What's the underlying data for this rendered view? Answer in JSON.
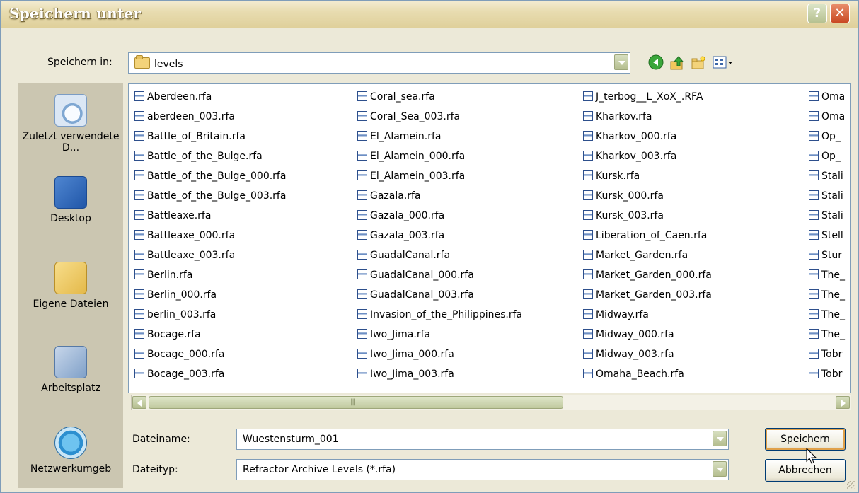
{
  "window": {
    "title": "Speichern unter"
  },
  "save_in": {
    "label": "Speichern in:",
    "value": "levels"
  },
  "toolbar": {
    "back_icon": "back-arrow-icon",
    "up_icon": "up-folder-icon",
    "new_folder_icon": "new-folder-icon",
    "view_icon": "view-menu-icon"
  },
  "places": [
    {
      "id": "recent",
      "label": "Zuletzt verwendete D..."
    },
    {
      "id": "desktop",
      "label": "Desktop"
    },
    {
      "id": "docs",
      "label": "Eigene Dateien"
    },
    {
      "id": "mycomp",
      "label": "Arbeitsplatz"
    },
    {
      "id": "network",
      "label": "Netzwerkumgeb"
    }
  ],
  "files": [
    [
      "Aberdeen.rfa",
      "aberdeen_003.rfa",
      "Battle_of_Britain.rfa",
      "Battle_of_the_Bulge.rfa",
      "Battle_of_the_Bulge_000.rfa",
      "Battle_of_the_Bulge_003.rfa",
      "Battleaxe.rfa",
      "Battleaxe_000.rfa",
      "Battleaxe_003.rfa",
      "Berlin.rfa",
      "Berlin_000.rfa",
      "berlin_003.rfa",
      "Bocage.rfa",
      "Bocage_000.rfa",
      "Bocage_003.rfa"
    ],
    [
      "Coral_sea.rfa",
      "Coral_Sea_003.rfa",
      "El_Alamein.rfa",
      "El_Alamein_000.rfa",
      "El_Alamein_003.rfa",
      "Gazala.rfa",
      "Gazala_000.rfa",
      "Gazala_003.rfa",
      "GuadalCanal.rfa",
      "GuadalCanal_000.rfa",
      "GuadalCanal_003.rfa",
      "Invasion_of_the_Philippines.rfa",
      "Iwo_Jima.rfa",
      "Iwo_Jima_000.rfa",
      "Iwo_Jima_003.rfa"
    ],
    [
      "J_terbog__L_XoX_.RFA",
      "Kharkov.rfa",
      "Kharkov_000.rfa",
      "Kharkov_003.rfa",
      "Kursk.rfa",
      "Kursk_000.rfa",
      "Kursk_003.rfa",
      "Liberation_of_Caen.rfa",
      "Market_Garden.rfa",
      "Market_Garden_000.rfa",
      "Market_Garden_003.rfa",
      "Midway.rfa",
      "Midway_000.rfa",
      "Midway_003.rfa",
      "Omaha_Beach.rfa"
    ],
    [
      "Oma",
      "Oma",
      "Op_",
      "Op_",
      "Stali",
      "Stali",
      "Stali",
      "Stell",
      "Stur",
      "The_",
      "The_",
      "The_",
      "The_",
      "Tobr",
      "Tobr"
    ]
  ],
  "filename": {
    "label": "Dateiname:",
    "value": "Wuestensturm_001"
  },
  "filetype": {
    "label": "Dateityp:",
    "value": "Refractor Archive Levels (*.rfa)"
  },
  "buttons": {
    "save": "Speichern",
    "cancel": "Abbrechen"
  }
}
